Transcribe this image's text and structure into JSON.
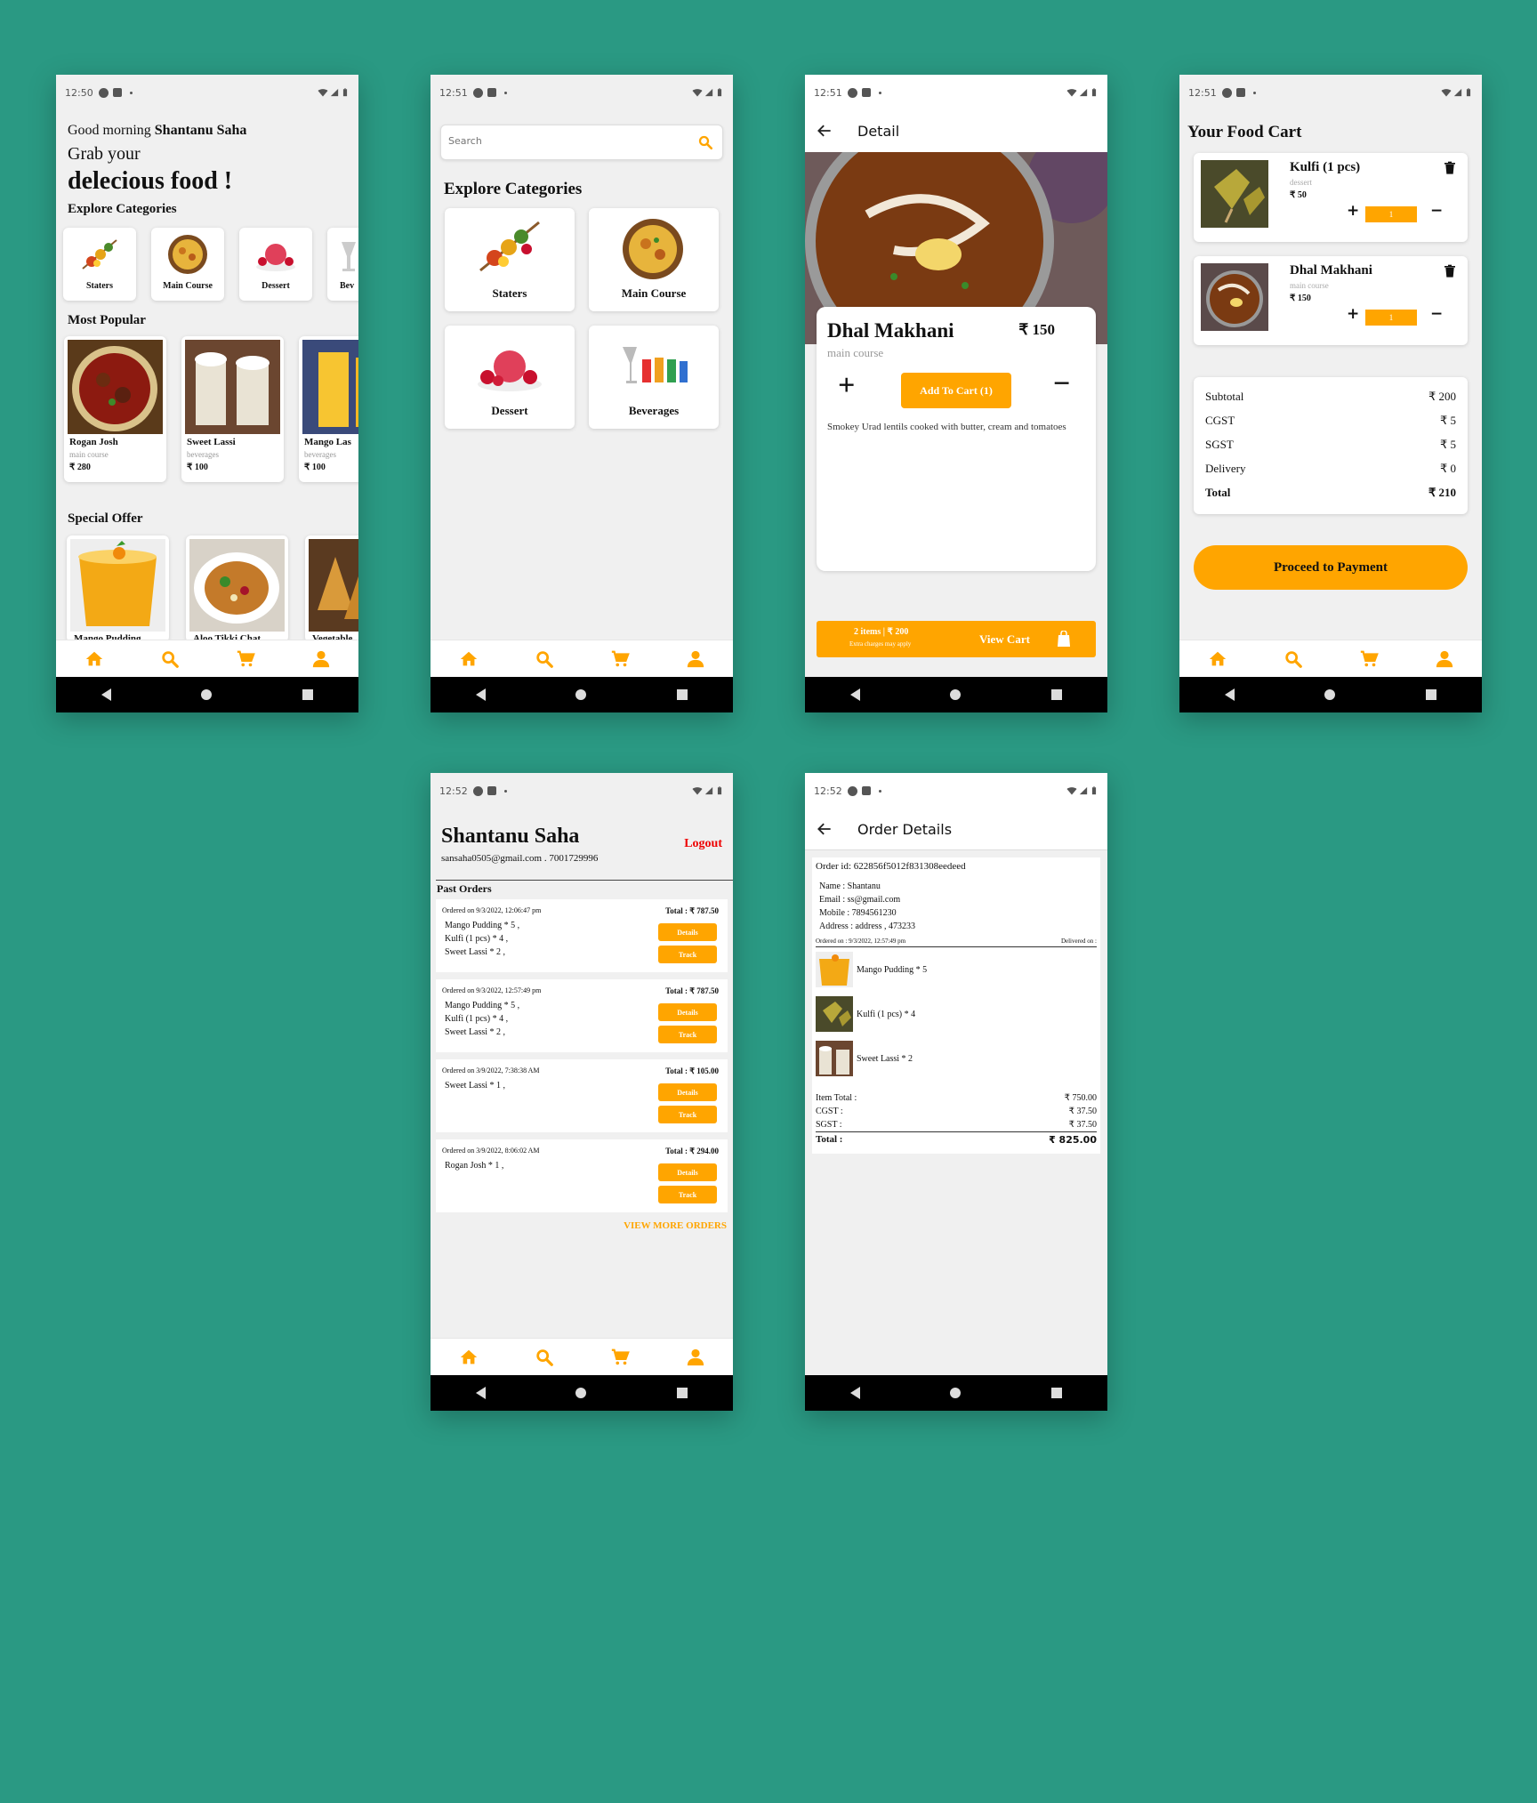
{
  "status_times": [
    "12:50",
    "12:51",
    "12:51",
    "12:51",
    "12:52",
    "12:52"
  ],
  "accent_color": "#ffa500",
  "background_color": "#2a9983",
  "home": {
    "greeting": "Good morning",
    "user_name": "Shantanu Saha",
    "grab": "Grab your",
    "headline": "delecious food !",
    "explore_title": "Explore Categories",
    "categories": [
      {
        "label": "Staters",
        "icon": "skewer-icon"
      },
      {
        "label": "Main Course",
        "icon": "biryani-icon"
      },
      {
        "label": "Dessert",
        "icon": "icecream-icon"
      },
      {
        "label": "Bev",
        "icon": "drinks-icon"
      }
    ],
    "popular_title": "Most Popular",
    "popular": [
      {
        "name": "Rogan Josh",
        "category": "main course",
        "price": "₹ 280"
      },
      {
        "name": "Sweet Lassi",
        "category": "beverages",
        "price": "₹ 100"
      },
      {
        "name": "Mango Las",
        "category": "beverages",
        "price": "₹ 100"
      }
    ],
    "offer_title": "Special Offer",
    "offers": [
      {
        "name": "Mango Pudding"
      },
      {
        "name": "Aloo Tikki Chat"
      },
      {
        "name": "Vegetable"
      }
    ]
  },
  "search": {
    "placeholder": "Search",
    "explore_title": "Explore Categories",
    "categories": [
      "Staters",
      "Main Course",
      "Dessert",
      "Beverages"
    ]
  },
  "detail": {
    "header": "Detail",
    "name": "Dhal Makhani",
    "price": "₹ 150",
    "category": "main course",
    "plus": "+",
    "minus": "−",
    "add_button": "Add To Cart (1)",
    "description": "Smokey Urad lentils cooked with butter, cream and tomatoes",
    "cart_items": "2 items | ₹ 200",
    "cart_note": "Extra charges may apply",
    "view_cart": "View Cart"
  },
  "cart": {
    "title": "Your Food Cart",
    "items": [
      {
        "name": "Kulfi (1 pcs)",
        "category": "dessert",
        "price": "₹ 50",
        "qty": "1"
      },
      {
        "name": "Dhal Makhani",
        "category": "main course",
        "price": "₹ 150",
        "qty": "1"
      }
    ],
    "summary": [
      {
        "label": "Subtotal",
        "value": "₹ 200"
      },
      {
        "label": "CGST",
        "value": "₹ 5"
      },
      {
        "label": "SGST",
        "value": "₹ 5"
      },
      {
        "label": "Delivery",
        "value": "₹ 0"
      },
      {
        "label": "Total",
        "value": "₹ 210"
      }
    ],
    "proceed": "Proceed to Payment"
  },
  "profile": {
    "name": "Shantanu Saha",
    "contact": "sansaha0505@gmail.com . 7001729996",
    "logout": "Logout",
    "past_orders": "Past Orders",
    "orders": [
      {
        "date": "Ordered on 9/3/2022, 12:06:47 pm",
        "total": "Total : ₹ 787.50",
        "items": [
          "Mango Pudding * 5 ,",
          "Kulfi (1 pcs) * 4 ,",
          "Sweet Lassi * 2 ,"
        ]
      },
      {
        "date": "Ordered on 9/3/2022, 12:57:49 pm",
        "total": "Total : ₹ 787.50",
        "items": [
          "Mango Pudding * 5 ,",
          "Kulfi (1 pcs) * 4 ,",
          "Sweet Lassi * 2 ,"
        ]
      },
      {
        "date": "Ordered on 3/9/2022, 7:38:38 AM",
        "total": "Total : ₹ 105.00",
        "items": [
          "Sweet Lassi * 1 ,"
        ]
      },
      {
        "date": "Ordered on 3/9/2022, 8:06:02 AM",
        "total": "Total : ₹ 294.00",
        "items": [
          "Rogan Josh  * 1 ,"
        ]
      }
    ],
    "details_btn": "Details",
    "track_btn": "Track",
    "view_more": "VIEW MORE ORDERS"
  },
  "order_details": {
    "header": "Order Details",
    "order_id": "Order id: 622856f5012f831308eedeed",
    "name": "Name : Shantanu",
    "email": "Email : ss@gmail.com",
    "mobile": "Mobile : 7894561230",
    "address": "Address : address , 473233",
    "ordered_on": "Ordered on : 9/3/2022, 12:57:49 pm",
    "delivered_on": "Delivered on :",
    "items": [
      "Mango Pudding * 5",
      "Kulfi (1 pcs) * 4",
      "Sweet Lassi * 2"
    ],
    "totals": [
      {
        "label": "Item Total :",
        "value": "₹ 750.00"
      },
      {
        "label": "CGST :",
        "value": "₹ 37.50"
      },
      {
        "label": "SGST :",
        "value": "₹ 37.50"
      }
    ],
    "grand_label": "Total :",
    "grand_value": "₹ 825.00"
  }
}
